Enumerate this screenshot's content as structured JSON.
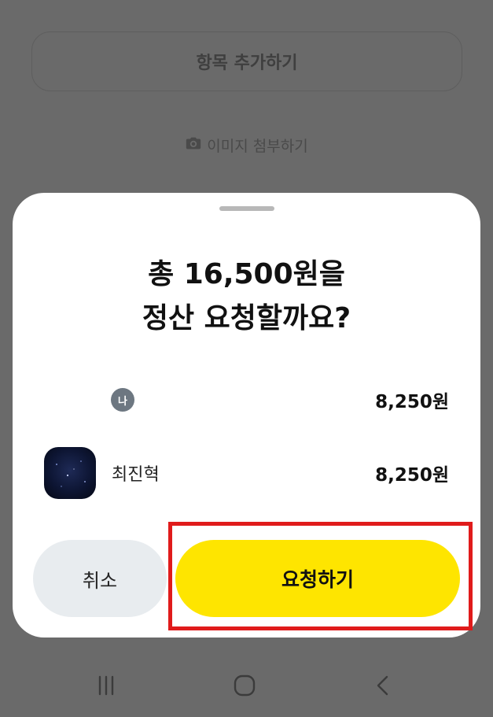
{
  "background": {
    "add_item_label": "항목 추가하기",
    "attach_image_label": "이미지 첨부하기",
    "camera_icon": "camera-icon"
  },
  "sheet": {
    "title_line1": "총 16,500원을",
    "title_line2": "정산 요청할까요?",
    "participants": [
      {
        "badge": "나",
        "name": "",
        "amount": "8,250원"
      },
      {
        "name": "최진혁",
        "amount": "8,250원",
        "avatar": "night-sky-avatar"
      }
    ],
    "cancel_label": "취소",
    "request_label": "요청하기"
  },
  "colors": {
    "accent": "#FEE500",
    "cancel_bg": "#E8ECEF",
    "highlight": "#E01B1B",
    "dim_overlay": "#6A6A6A"
  },
  "navbar": {
    "icons": [
      "recent-apps-icon",
      "home-icon",
      "back-icon"
    ]
  }
}
